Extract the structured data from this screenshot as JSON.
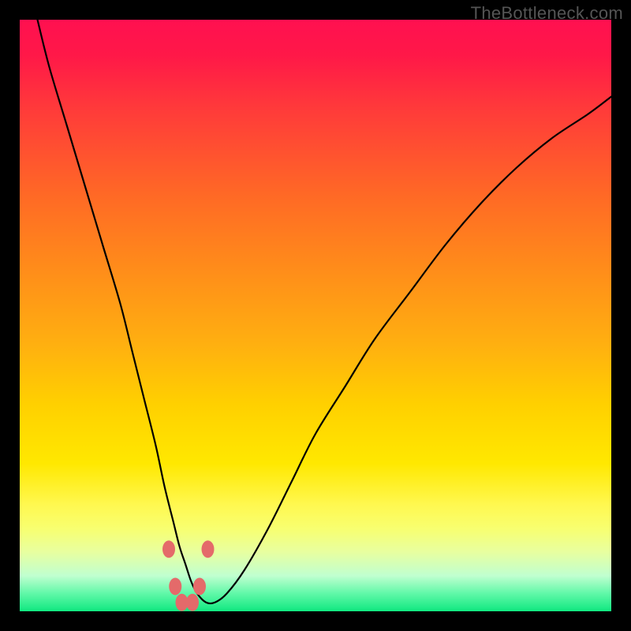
{
  "watermark": "TheBottleneck.com",
  "chart_data": {
    "type": "line",
    "title": "",
    "xlabel": "",
    "ylabel": "",
    "xlim": [
      0,
      100
    ],
    "ylim": [
      0,
      100
    ],
    "series": [
      {
        "name": "curve",
        "x": [
          3,
          5,
          8,
          11,
          14,
          17,
          19,
          21,
          23,
          24.5,
          26,
          27,
          28,
          29,
          30,
          31.5,
          33,
          35,
          38,
          42,
          46,
          50,
          55,
          60,
          66,
          72,
          78,
          84,
          90,
          96,
          100
        ],
        "y": [
          100,
          92,
          82,
          72,
          62,
          52,
          44,
          36,
          28,
          21,
          15,
          11,
          8,
          5,
          3,
          1.5,
          1.5,
          3,
          7,
          14,
          22,
          30,
          38,
          46,
          54,
          62,
          69,
          75,
          80,
          84,
          87
        ]
      }
    ],
    "markers": [
      {
        "x": 25.2,
        "y": 10.5
      },
      {
        "x": 31.8,
        "y": 10.5
      },
      {
        "x": 26.3,
        "y": 4.2
      },
      {
        "x": 30.4,
        "y": 4.2
      },
      {
        "x": 27.4,
        "y": 1.5
      },
      {
        "x": 29.2,
        "y": 1.5
      }
    ],
    "marker_color": "#e46a6a",
    "curve_color": "#000000",
    "gradient_stops": [
      {
        "pos": 0,
        "color": "#ff1050"
      },
      {
        "pos": 15,
        "color": "#ff3a3a"
      },
      {
        "pos": 42,
        "color": "#ff8c1a"
      },
      {
        "pos": 65,
        "color": "#ffd000"
      },
      {
        "pos": 86,
        "color": "#f8ff70"
      },
      {
        "pos": 100,
        "color": "#10e880"
      }
    ]
  }
}
